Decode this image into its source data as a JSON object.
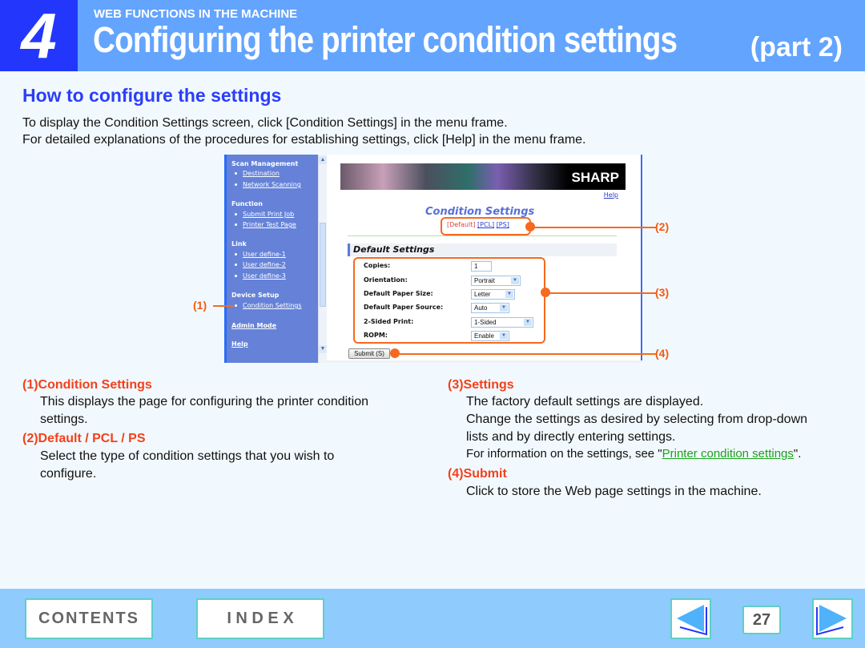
{
  "header": {
    "chapter_number": "4",
    "section_label": "WEB FUNCTIONS IN THE MACHINE",
    "title": "Configuring the printer condition settings",
    "part": "(part 2)"
  },
  "heading": "How to configure the settings",
  "intro": [
    "To display the Condition Settings screen, click [Condition Settings] in the menu frame.",
    "For detailed explanations of the procedures for establishing settings, click [Help] in the menu frame."
  ],
  "screenshot": {
    "menu": {
      "sections": [
        {
          "title": "Scan Management",
          "items": [
            "Destination",
            "Network Scanning"
          ]
        },
        {
          "title": "Function",
          "items": [
            "Submit Print Job",
            "Printer Test Page"
          ]
        },
        {
          "title": "Link",
          "items": [
            "User define-1",
            "User define-2",
            "User define-3"
          ]
        },
        {
          "title": "Device Setup",
          "items": [
            "Condition Settings"
          ]
        }
      ],
      "admin_mode": "Admin Mode",
      "help": "Help"
    },
    "logo": "SHARP",
    "help_link": "Help",
    "page_title": "Condition Settings",
    "tabs": {
      "current": "[Default]",
      "pcl": "[PCL]",
      "ps": "[PS]"
    },
    "section_title": "Default Settings",
    "fields": [
      {
        "label": "Copies:",
        "value": "1",
        "type": "text"
      },
      {
        "label": "Orientation:",
        "value": "Portrait",
        "type": "select"
      },
      {
        "label": "Default Paper Size:",
        "value": "Letter",
        "type": "select"
      },
      {
        "label": "Default Paper Source:",
        "value": "Auto",
        "type": "select"
      },
      {
        "label": "2-Sided Print:",
        "value": "1-Sided",
        "type": "select"
      },
      {
        "label": "ROPM:",
        "value": "Enable",
        "type": "select"
      }
    ],
    "submit_label": "Submit (S)"
  },
  "callouts": {
    "c1": "(1)",
    "c2": "(2)",
    "c3": "(3)",
    "c4": "(4)"
  },
  "descriptions": {
    "d1": {
      "heading": "(1)Condition Settings",
      "lines": [
        "This displays the page for configuring the printer condition",
        "settings."
      ]
    },
    "d2": {
      "heading": "(2)Default / PCL / PS",
      "lines": [
        "Select the type of condition settings that you wish to",
        "configure."
      ]
    },
    "d3": {
      "heading": "(3)Settings",
      "lines": [
        "The factory default settings are displayed.",
        "Change the settings as desired by selecting from drop-down",
        "lists and by directly entering settings."
      ],
      "link_prefix": "For information on the settings, see \"",
      "link_text": "Printer condition settings",
      "link_suffix": "\"."
    },
    "d4": {
      "heading": "(4)Submit",
      "lines": [
        "Click to store the Web page settings in the machine."
      ]
    }
  },
  "footer": {
    "contents": "CONTENTS",
    "index": "I N D E X",
    "page": "27",
    "prev_icon": "left-triangle-icon",
    "next_icon": "right-triangle-icon"
  }
}
